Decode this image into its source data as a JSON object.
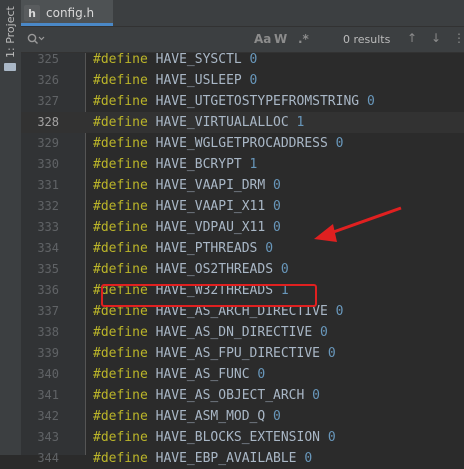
{
  "sidebar": {
    "label": "1: Project"
  },
  "tab": {
    "icon": "h",
    "title": "config.h"
  },
  "search": {
    "placeholder": "",
    "opt_aa": "Aa",
    "opt_w": "W",
    "opt_regex": ".*",
    "results": "0 results"
  },
  "colors": {
    "keyword": "#bbb529",
    "identifier": "#a9b7c6",
    "number": "#6897bb",
    "highlight": "#e02020"
  },
  "editor": {
    "current_line": "328",
    "lines": [
      {
        "num": "325",
        "kw": "#define",
        "name": "HAVE_SYSCTL",
        "val": "0"
      },
      {
        "num": "326",
        "kw": "#define",
        "name": "HAVE_USLEEP",
        "val": "0"
      },
      {
        "num": "327",
        "kw": "#define",
        "name": "HAVE_UTGETOSTYPEFROMSTRING",
        "val": "0"
      },
      {
        "num": "328",
        "kw": "#define",
        "name": "HAVE_VIRTUALALLOC",
        "val": "1"
      },
      {
        "num": "329",
        "kw": "#define",
        "name": "HAVE_WGLGETPROCADDRESS",
        "val": "0"
      },
      {
        "num": "330",
        "kw": "#define",
        "name": "HAVE_BCRYPT",
        "val": "1"
      },
      {
        "num": "331",
        "kw": "#define",
        "name": "HAVE_VAAPI_DRM",
        "val": "0"
      },
      {
        "num": "332",
        "kw": "#define",
        "name": "HAVE_VAAPI_X11",
        "val": "0"
      },
      {
        "num": "333",
        "kw": "#define",
        "name": "HAVE_VDPAU_X11",
        "val": "0"
      },
      {
        "num": "334",
        "kw": "#define",
        "name": "HAVE_PTHREADS",
        "val": "0"
      },
      {
        "num": "335",
        "kw": "#define",
        "name": "HAVE_OS2THREADS",
        "val": "0"
      },
      {
        "num": "336",
        "kw": "#define",
        "name": "HAVE_W32THREADS",
        "val": "1"
      },
      {
        "num": "337",
        "kw": "#define",
        "name": "HAVE_AS_ARCH_DIRECTIVE",
        "val": "0"
      },
      {
        "num": "338",
        "kw": "#define",
        "name": "HAVE_AS_DN_DIRECTIVE",
        "val": "0"
      },
      {
        "num": "339",
        "kw": "#define",
        "name": "HAVE_AS_FPU_DIRECTIVE",
        "val": "0"
      },
      {
        "num": "340",
        "kw": "#define",
        "name": "HAVE_AS_FUNC",
        "val": "0"
      },
      {
        "num": "341",
        "kw": "#define",
        "name": "HAVE_AS_OBJECT_ARCH",
        "val": "0"
      },
      {
        "num": "342",
        "kw": "#define",
        "name": "HAVE_ASM_MOD_Q",
        "val": "0"
      },
      {
        "num": "343",
        "kw": "#define",
        "name": "HAVE_BLOCKS_EXTENSION",
        "val": "0"
      },
      {
        "num": "344",
        "kw": "#define",
        "name": "HAVE_EBP_AVAILABLE",
        "val": "0"
      }
    ]
  }
}
